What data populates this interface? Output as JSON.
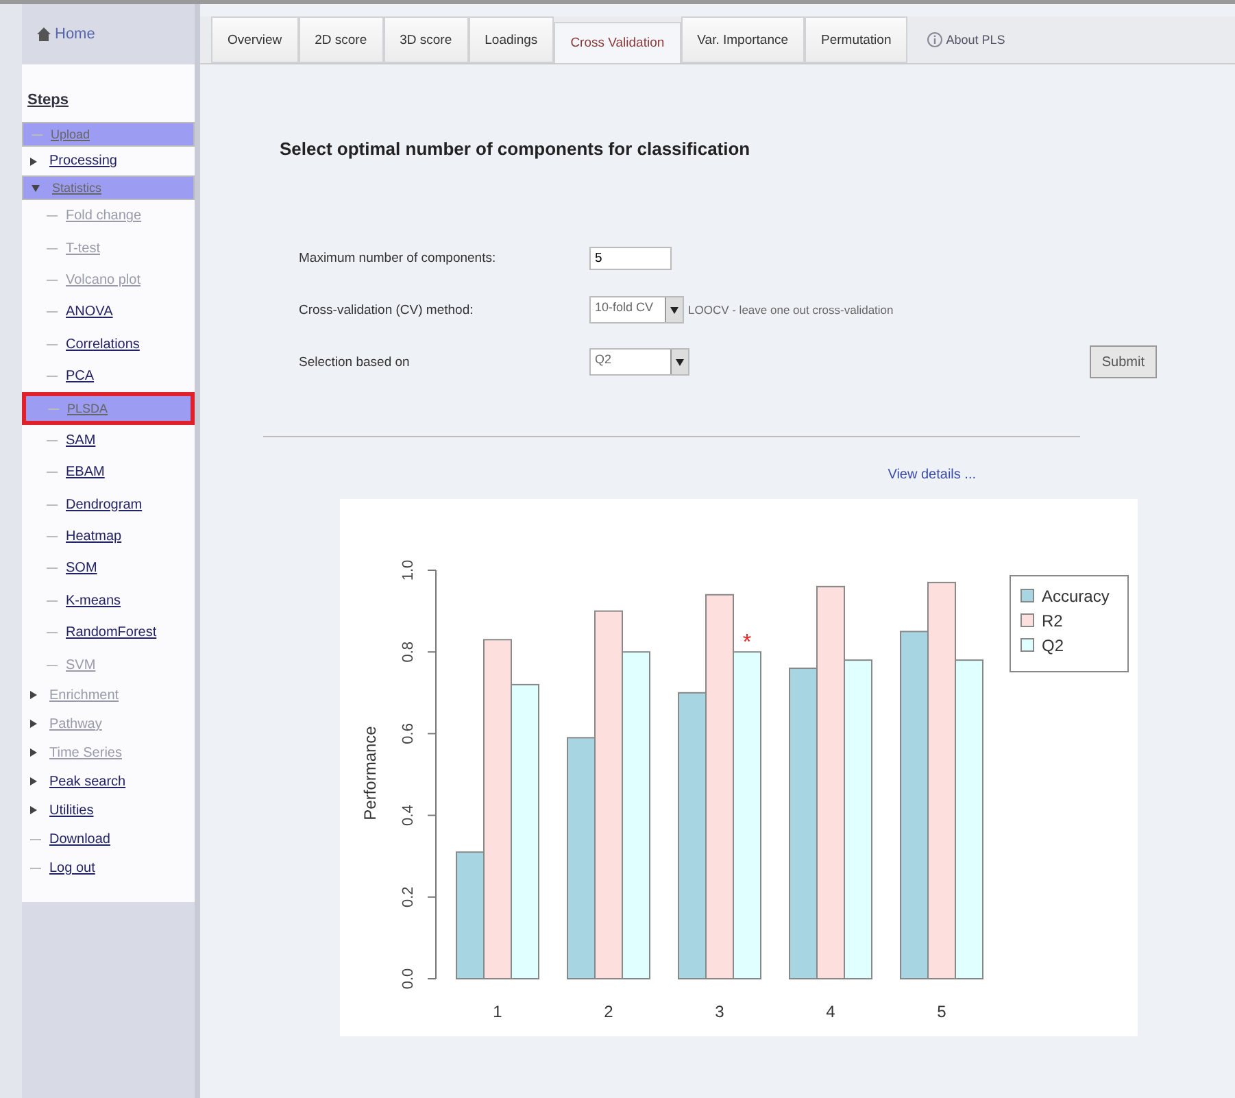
{
  "sidebar": {
    "home": "Home",
    "heading": "Steps",
    "items": [
      {
        "label": "Upload",
        "kind": "link",
        "selected": true,
        "disabled": false
      },
      {
        "label": "Processing",
        "kind": "group",
        "expanded": false,
        "selected": false,
        "disabled": false
      },
      {
        "label": "Statistics",
        "kind": "group",
        "expanded": true,
        "selected": true,
        "disabled": false,
        "children": [
          {
            "label": "Fold change",
            "selected": false,
            "disabled": true,
            "outlined": false
          },
          {
            "label": "T-test",
            "selected": false,
            "disabled": true,
            "outlined": false
          },
          {
            "label": "Volcano plot",
            "selected": false,
            "disabled": true,
            "outlined": false
          },
          {
            "label": "ANOVA",
            "selected": false,
            "disabled": false,
            "outlined": false
          },
          {
            "label": "Correlations",
            "selected": false,
            "disabled": false,
            "outlined": false
          },
          {
            "label": "PCA",
            "selected": false,
            "disabled": false,
            "outlined": false
          },
          {
            "label": "PLSDA",
            "selected": true,
            "disabled": false,
            "outlined": true
          },
          {
            "label": "SAM",
            "selected": false,
            "disabled": false,
            "outlined": false
          },
          {
            "label": "EBAM",
            "selected": false,
            "disabled": false,
            "outlined": false
          },
          {
            "label": "Dendrogram",
            "selected": false,
            "disabled": false,
            "outlined": false
          },
          {
            "label": "Heatmap",
            "selected": false,
            "disabled": false,
            "outlined": false
          },
          {
            "label": "SOM",
            "selected": false,
            "disabled": false,
            "outlined": false
          },
          {
            "label": "K-means",
            "selected": false,
            "disabled": false,
            "outlined": false
          },
          {
            "label": "RandomForest",
            "selected": false,
            "disabled": false,
            "outlined": false
          },
          {
            "label": "SVM",
            "selected": false,
            "disabled": true,
            "outlined": false
          }
        ]
      },
      {
        "label": "Enrichment",
        "kind": "group",
        "expanded": false,
        "selected": false,
        "disabled": true
      },
      {
        "label": "Pathway",
        "kind": "group",
        "expanded": false,
        "selected": false,
        "disabled": true
      },
      {
        "label": "Time Series",
        "kind": "group",
        "expanded": false,
        "selected": false,
        "disabled": true
      },
      {
        "label": "Peak search",
        "kind": "group",
        "expanded": false,
        "selected": false,
        "disabled": false
      },
      {
        "label": "Utilities",
        "kind": "group",
        "expanded": false,
        "selected": false,
        "disabled": false
      },
      {
        "label": "Download",
        "kind": "link",
        "selected": false,
        "disabled": false
      },
      {
        "label": "Log out",
        "kind": "link",
        "selected": false,
        "disabled": false
      }
    ]
  },
  "tabs": [
    {
      "label": "Overview",
      "selected": false
    },
    {
      "label": "2D score",
      "selected": false
    },
    {
      "label": "3D score",
      "selected": false
    },
    {
      "label": "Loadings",
      "selected": false
    },
    {
      "label": "Cross Validation",
      "selected": true
    },
    {
      "label": "Var. Importance",
      "selected": false
    },
    {
      "label": "Permutation",
      "selected": false
    }
  ],
  "about_link": "About PLS",
  "heading": "Select optimal number of components for classification",
  "form": {
    "max_components": {
      "label": "Maximum number of components:",
      "value": "5"
    },
    "cv_method": {
      "label": "Cross-validation (CV) method:",
      "value": "10-fold CV",
      "note": "LOOCV - leave one out cross-validation"
    },
    "selection": {
      "label": "Selection based on",
      "value": "Q2"
    },
    "submit": "Submit"
  },
  "view_details": "View details ...",
  "chart_data": {
    "type": "bar",
    "ylabel": "Performance",
    "categories": [
      "1",
      "2",
      "3",
      "4",
      "5"
    ],
    "ylim": [
      0,
      1
    ],
    "yticks": [
      {
        "value": 0,
        "label": "0.0"
      },
      0.2,
      0.4,
      0.6,
      0.8,
      {
        "value": 1,
        "label": "1.0"
      }
    ],
    "legend": true,
    "series": [
      {
        "name": "Accuracy",
        "color": "#a8d5e2",
        "values": [
          0.31,
          0.59,
          0.7,
          0.76,
          0.85
        ]
      },
      {
        "name": "R2",
        "color": "#fde0dd",
        "values": [
          0.83,
          0.9,
          0.94,
          0.96,
          0.97
        ]
      },
      {
        "name": "Q2",
        "color": "#e0ffff",
        "values": [
          0.72,
          0.8,
          0.8,
          0.78,
          0.78
        ]
      }
    ],
    "annotations": [
      "*"
    ]
  }
}
